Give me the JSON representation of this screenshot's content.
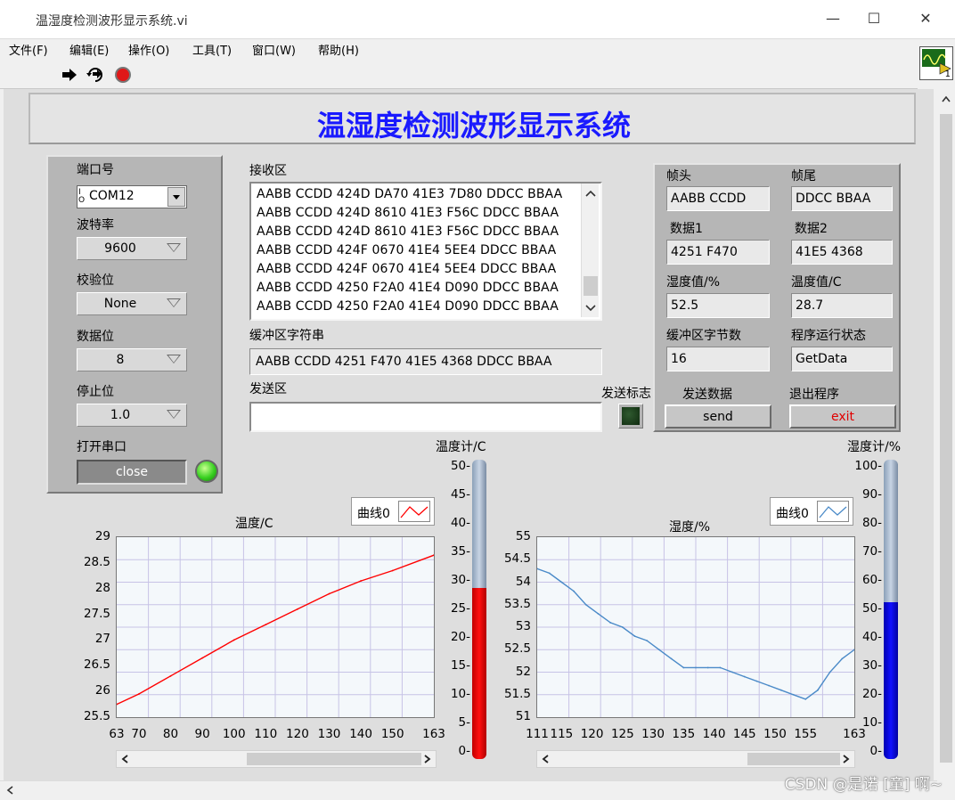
{
  "window": {
    "title": "温湿度检测波形显示系统.vi",
    "minimize": "—",
    "maximize": "☐",
    "close": "✕"
  },
  "menu": [
    "文件(F)",
    "编辑(E)",
    "操作(O)",
    "工具(T)",
    "窗口(W)",
    "帮助(H)"
  ],
  "vi_icon_number": "1",
  "panel_title": "温湿度检测波形显示系统",
  "serial": {
    "port_label": "端口号",
    "port_value": "COM12",
    "port_prefix": "I/O",
    "baud_label": "波特率",
    "baud_value": "9600",
    "parity_label": "校验位",
    "parity_value": "None",
    "databits_label": "数据位",
    "databits_value": "8",
    "stopbits_label": "停止位",
    "stopbits_value": "1.0",
    "open_label": "打开串口",
    "open_button": "close"
  },
  "receive": {
    "label": "接收区",
    "lines": [
      "AABB CCDD 424D DA70 41E3 7D80 DDCC BBAA",
      "AABB CCDD 424D 8610 41E3 F56C DDCC BBAA",
      "AABB CCDD 424D 8610 41E3 F56C DDCC BBAA",
      "AABB CCDD 424F 0670 41E4 5EE4 DDCC BBAA",
      "AABB CCDD 424F 0670 41E4 5EE4 DDCC BBAA",
      "AABB CCDD 4250 F2A0 41E4 D090 DDCC BBAA",
      "AABB CCDD 4250 F2A0 41E4 D090 DDCC BBAA"
    ]
  },
  "buffer": {
    "label": "缓冲区字符串",
    "value": "AABB CCDD 4251 F470 41E5 4368 DDCC BBAA"
  },
  "send": {
    "label": "发送区",
    "value": "",
    "flag_label": "发送标志"
  },
  "status": {
    "header_label": "帧头",
    "header_value": "AABB CCDD",
    "tail_label": "帧尾",
    "tail_value": "DDCC BBAA",
    "data1_label": "数据1",
    "data1_value": "4251 F470",
    "data2_label": "数据2",
    "data2_value": "41E5 4368",
    "humidity_label": "湿度值/%",
    "humidity_value": "52.5",
    "temperature_label": "温度值/C",
    "temperature_value": "28.7",
    "bytes_label": "缓冲区字节数",
    "bytes_value": "16",
    "state_label": "程序运行状态",
    "state_value": "GetData",
    "send_data_label": "发送数据",
    "send_button": "send",
    "exit_label": "退出程序",
    "exit_button": "exit"
  },
  "colors": {
    "temp_line": "#ff0000",
    "hum_line": "#4a8ac8",
    "temp_fill": "#ff0000",
    "hum_fill": "#0000ff",
    "title": "#1a1aff"
  },
  "chart_data": [
    {
      "type": "line",
      "title": "温度/C",
      "legend": "曲线0",
      "xlim": [
        63,
        163
      ],
      "ylim": [
        25.5,
        29
      ],
      "x_ticks": [
        63,
        70,
        80,
        90,
        100,
        110,
        120,
        130,
        140,
        150,
        163
      ],
      "y_ticks": [
        29,
        28.5,
        28,
        27.5,
        27,
        26.5,
        26,
        25.5
      ],
      "series": [
        {
          "x": [
            63,
            70,
            80,
            90,
            100,
            110,
            120,
            130,
            140,
            150,
            163
          ],
          "y": [
            25.75,
            25.95,
            26.3,
            26.65,
            27.0,
            27.3,
            27.6,
            27.9,
            28.15,
            28.35,
            28.65
          ]
        }
      ]
    },
    {
      "type": "line",
      "title": "湿度/%",
      "legend": "曲线0",
      "xlim": [
        111,
        163
      ],
      "ylim": [
        51,
        55
      ],
      "x_ticks": [
        111,
        115,
        120,
        125,
        130,
        135,
        140,
        145,
        150,
        155,
        163
      ],
      "y_ticks": [
        55,
        54.5,
        54,
        53.5,
        53,
        52.5,
        52,
        51.5,
        51
      ],
      "series": [
        {
          "x": [
            111,
            113,
            115,
            117,
            119,
            121,
            123,
            125,
            127,
            129,
            131,
            133,
            135,
            137,
            139,
            141,
            143,
            145,
            147,
            149,
            151,
            153,
            155,
            157,
            159,
            161,
            163
          ],
          "y": [
            54.3,
            54.2,
            54.0,
            53.8,
            53.5,
            53.3,
            53.1,
            53.0,
            52.8,
            52.7,
            52.5,
            52.3,
            52.1,
            52.1,
            52.1,
            52.1,
            52.0,
            51.9,
            51.8,
            51.7,
            51.6,
            51.5,
            51.4,
            51.6,
            52.0,
            52.3,
            52.5
          ]
        }
      ]
    },
    {
      "type": "bar",
      "title": "温度计/C",
      "ylim": [
        0,
        50
      ],
      "y_ticks": [
        50,
        45,
        40,
        35,
        30,
        25,
        20,
        15,
        10,
        5,
        0
      ],
      "values": [
        28.7
      ]
    },
    {
      "type": "bar",
      "title": "湿度计/%",
      "ylim": [
        0,
        100
      ],
      "y_ticks": [
        100,
        90,
        80,
        70,
        60,
        50,
        40,
        30,
        20,
        10,
        0
      ],
      "values": [
        52.5
      ]
    }
  ],
  "watermark": "CSDN @是诺 [童] 啊~"
}
